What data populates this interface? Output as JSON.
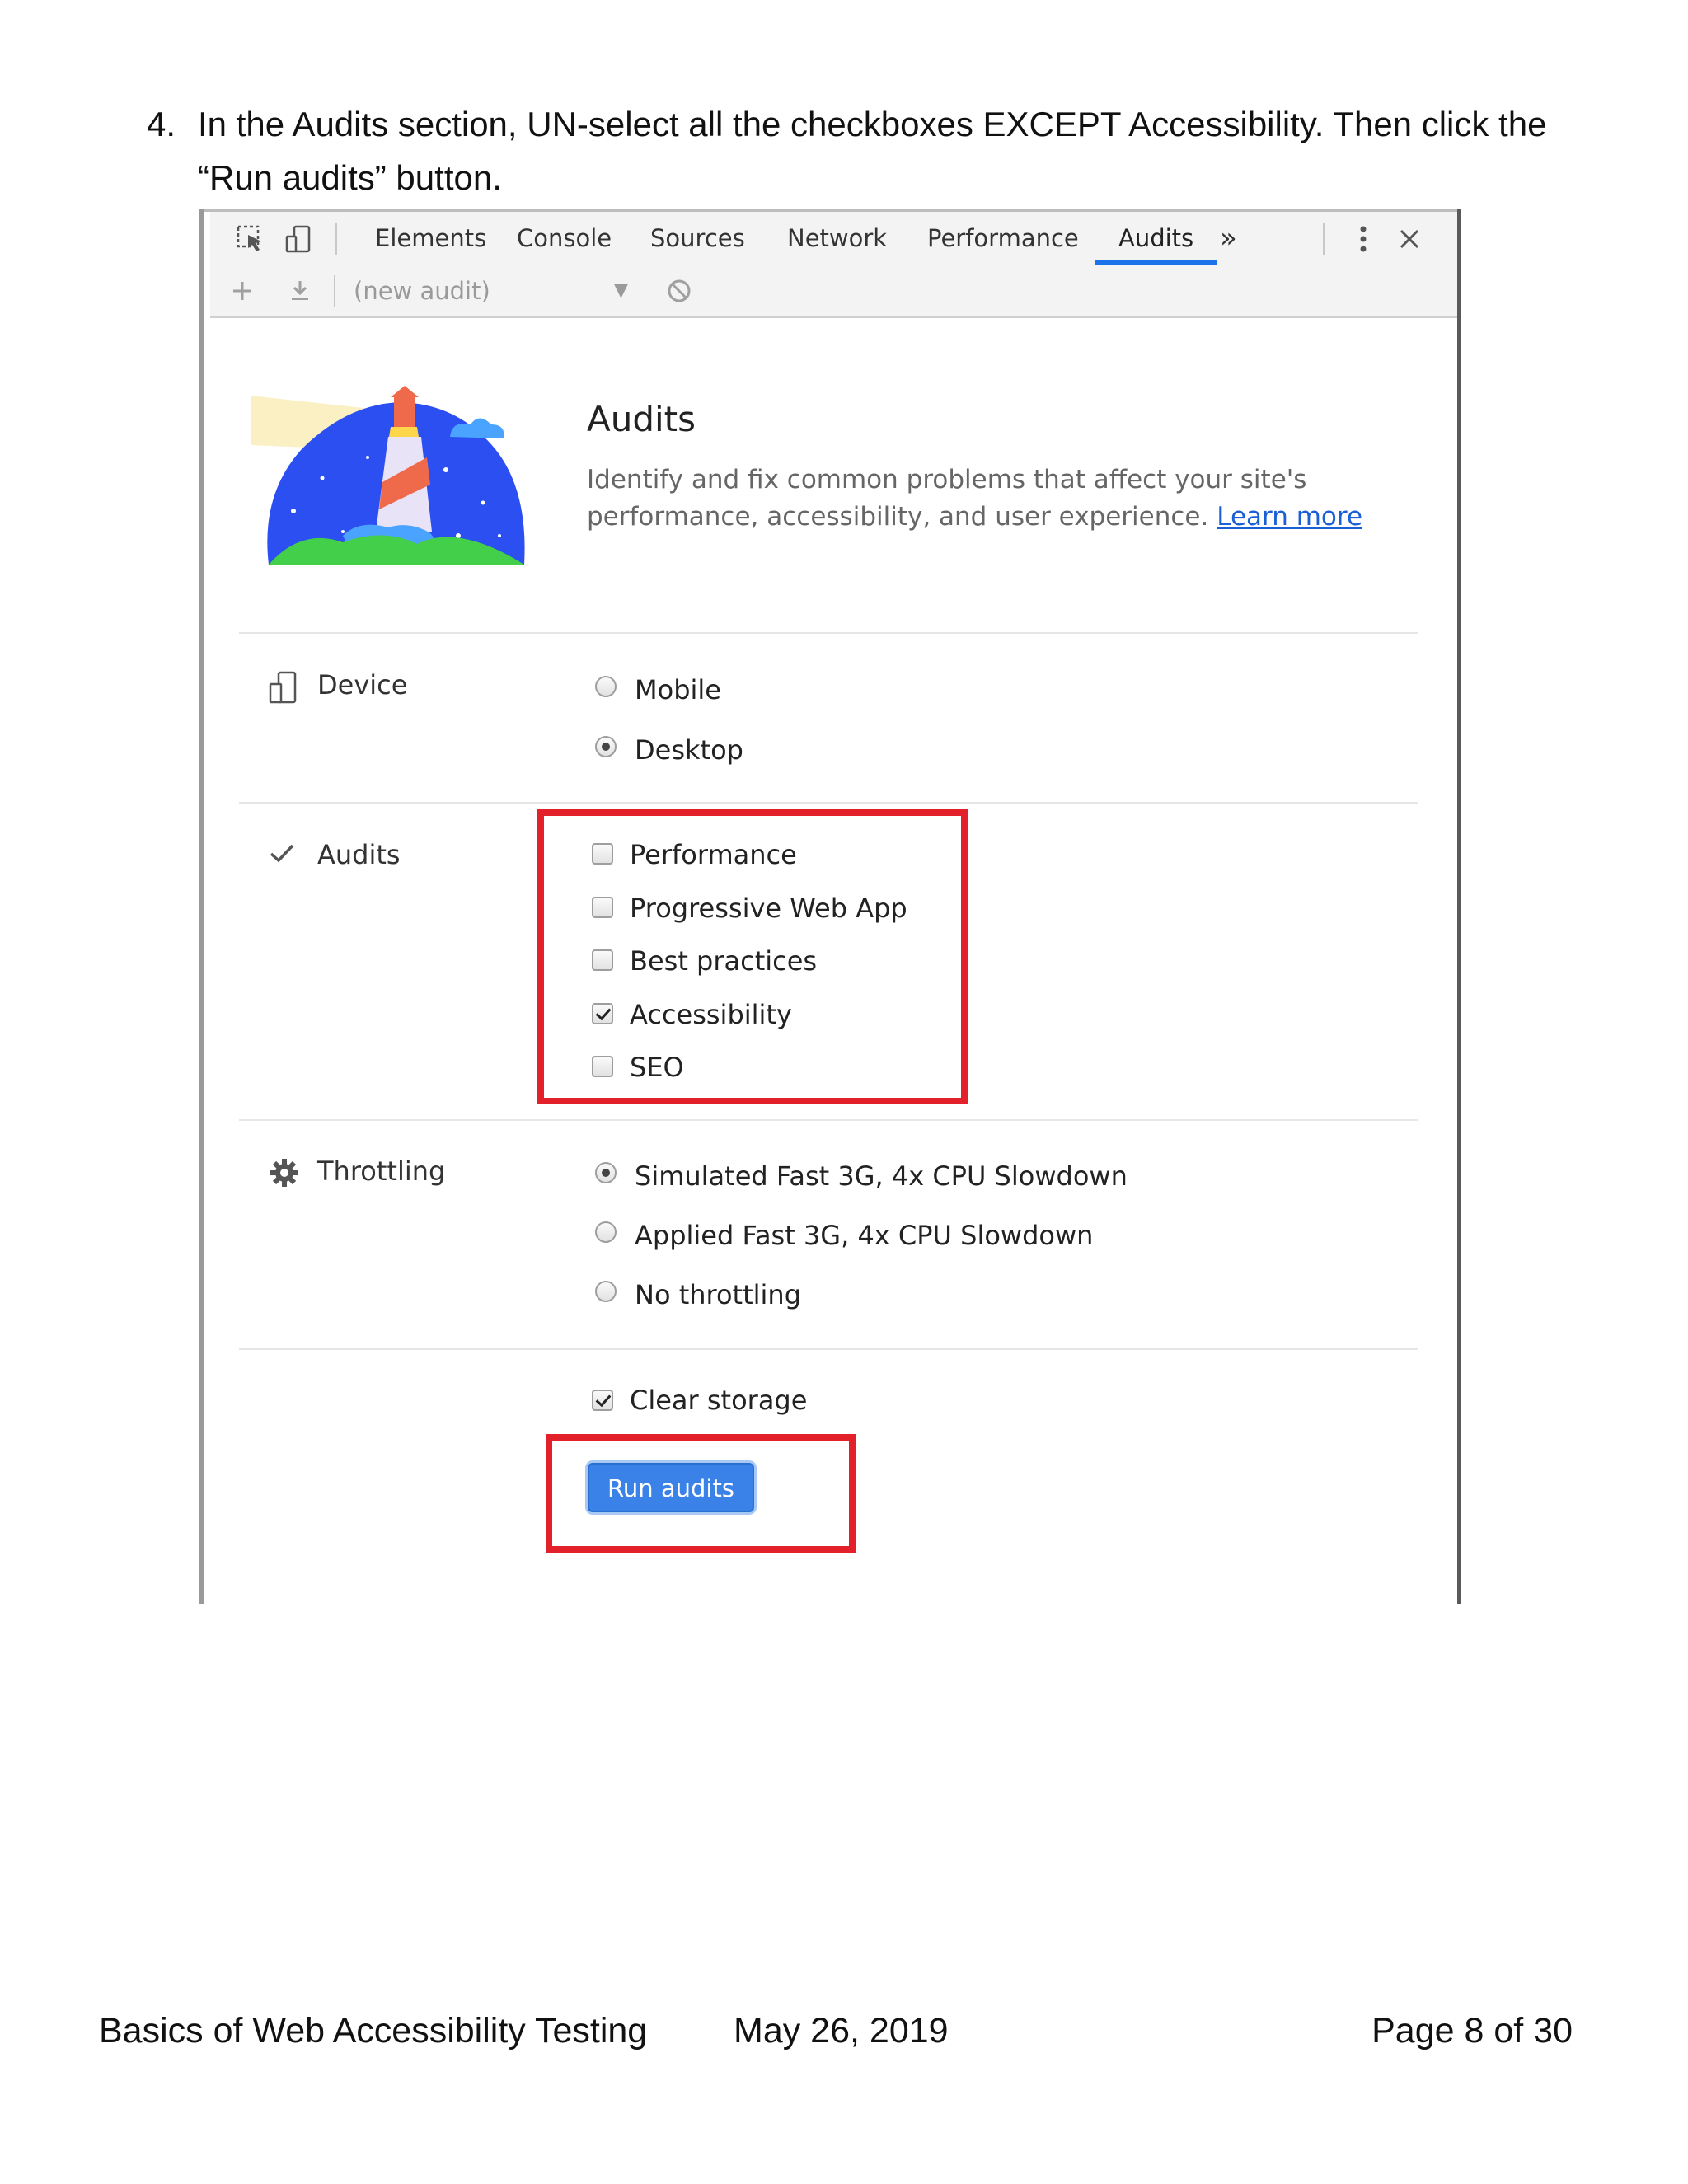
{
  "instruction": {
    "number": "4.",
    "text": "In the Audits section, UN-select all the checkboxes EXCEPT Accessibility. Then click the “Run audits” button."
  },
  "devtools": {
    "tabs": [
      "Elements",
      "Console",
      "Sources",
      "Network",
      "Performance",
      "Audits"
    ],
    "active_tab": "Audits",
    "more_tabs_glyph": "»",
    "audit_select_placeholder": "(new audit)"
  },
  "audits_panel": {
    "title": "Audits",
    "description": "Identify and fix common problems that affect your site's performance, accessibility, and user experience.",
    "learn_more": "Learn more",
    "device": {
      "label": "Device",
      "options": [
        {
          "label": "Mobile",
          "selected": false
        },
        {
          "label": "Desktop",
          "selected": true
        }
      ]
    },
    "audits": {
      "label": "Audits",
      "options": [
        {
          "label": "Performance",
          "checked": false
        },
        {
          "label": "Progressive Web App",
          "checked": false
        },
        {
          "label": "Best practices",
          "checked": false
        },
        {
          "label": "Accessibility",
          "checked": true
        },
        {
          "label": "SEO",
          "checked": false
        }
      ]
    },
    "throttling": {
      "label": "Throttling",
      "options": [
        {
          "label": "Simulated Fast 3G, 4x CPU Slowdown",
          "selected": true
        },
        {
          "label": "Applied Fast 3G, 4x CPU Slowdown",
          "selected": false
        },
        {
          "label": "No throttling",
          "selected": false
        }
      ]
    },
    "clear_storage": {
      "label": "Clear storage",
      "checked": true
    },
    "run_button": "Run audits",
    "highlight_color": "#e3212b",
    "accent_color": "#1a73e8"
  },
  "footer": {
    "title": "Basics of Web Accessibility Testing",
    "date": "May 26, 2019",
    "page": "Page 8 of 30"
  }
}
